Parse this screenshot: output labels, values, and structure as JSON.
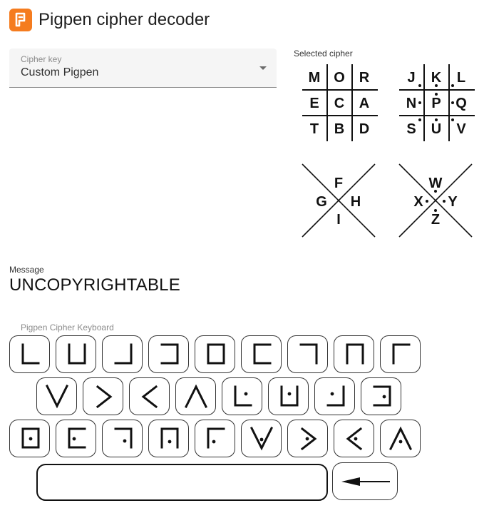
{
  "app": {
    "title": "Pigpen cipher decoder",
    "icon": "pigpen-logo-icon",
    "accent": "#f57c1f"
  },
  "cipher_key": {
    "label": "Cipher key",
    "value": "Custom Pigpen"
  },
  "selected_cipher": {
    "caption": "Selected cipher",
    "grid_plain": [
      [
        "M",
        "O",
        "R"
      ],
      [
        "E",
        "C",
        "A"
      ],
      [
        "T",
        "B",
        "D"
      ]
    ],
    "grid_dotted": [
      [
        "J",
        "K",
        "L"
      ],
      [
        "N",
        "P",
        "Q"
      ],
      [
        "S",
        "U",
        "V"
      ]
    ],
    "x_plain": {
      "top": "F",
      "left": "G",
      "right": "H",
      "bottom": "I"
    },
    "x_dotted": {
      "top": "W",
      "left": "X",
      "right": "Y",
      "bottom": "Z"
    }
  },
  "message": {
    "label": "Message",
    "value": "UNCOPYRIGHTABLE"
  },
  "keyboard": {
    "label": "Pigpen Cipher Keyboard",
    "rows": [
      [
        "grid-bottom-left",
        "grid-bottom-center",
        "grid-bottom-right",
        "grid-middle-left",
        "grid-middle-center",
        "grid-middle-right",
        "grid-top-left",
        "grid-top-center",
        "grid-top-right"
      ],
      [
        "x-top",
        "x-left",
        "x-right",
        "x-bottom",
        "dot-grid-bottom-left",
        "dot-grid-bottom-center",
        "dot-grid-bottom-right",
        "dot-grid-middle-left"
      ],
      [
        "dot-grid-middle-center",
        "dot-grid-middle-right",
        "dot-grid-top-left",
        "dot-grid-top-center",
        "dot-grid-top-right",
        "dot-x-top",
        "dot-x-left",
        "dot-x-right",
        "dot-x-bottom"
      ]
    ],
    "space_key": "space-key",
    "backspace_icon": "backspace-arrow-icon"
  }
}
